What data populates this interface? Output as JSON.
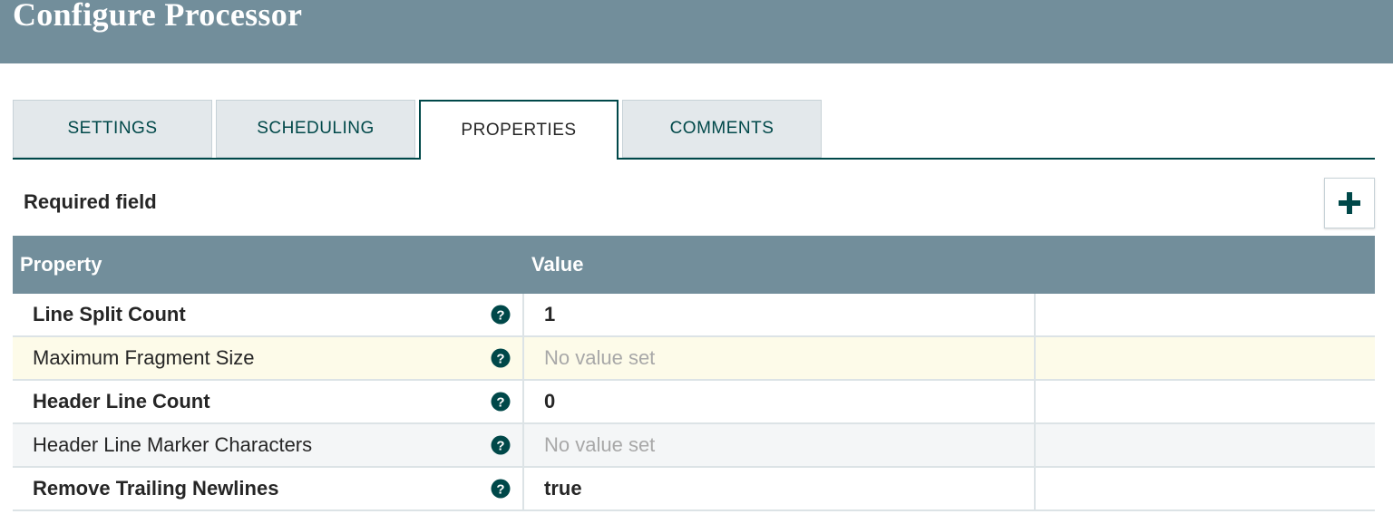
{
  "dialog": {
    "title": "Configure Processor"
  },
  "tabs": [
    {
      "label": "SETTINGS"
    },
    {
      "label": "SCHEDULING"
    },
    {
      "label": "PROPERTIES"
    },
    {
      "label": "COMMENTS"
    }
  ],
  "active_tab": "PROPERTIES",
  "properties_panel": {
    "required_label": "Required field",
    "add_button_icon": "plus-icon"
  },
  "table": {
    "columns": [
      "Property",
      "Value"
    ],
    "rows": [
      {
        "name": "Line Split Count",
        "required": true,
        "value": "1",
        "help_icon": "question-circle-icon"
      },
      {
        "name": "Maximum Fragment Size",
        "required": false,
        "value": "No value set",
        "help_icon": "question-circle-icon"
      },
      {
        "name": "Header Line Count",
        "required": true,
        "value": "0",
        "help_icon": "question-circle-icon"
      },
      {
        "name": "Header Line Marker Characters",
        "required": false,
        "value": "No value set",
        "help_icon": "question-circle-icon"
      },
      {
        "name": "Remove Trailing Newlines",
        "required": true,
        "value": "true",
        "help_icon": "question-circle-icon"
      }
    ]
  },
  "colors": {
    "header_bg": "#728e9b",
    "accent": "#004849",
    "highlight_row": "#fdfbe9",
    "unset_text": "#a8a8a8"
  }
}
